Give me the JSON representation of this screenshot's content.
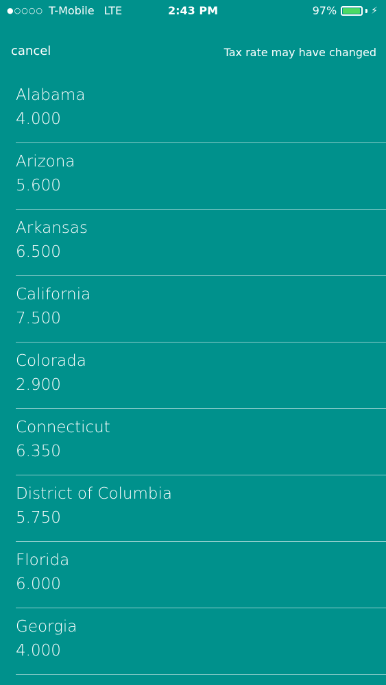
{
  "status_bar": {
    "signal": "●○○○○",
    "carrier": "T-Mobile",
    "network": "LTE",
    "time": "2:43 PM",
    "battery_percent": "97%",
    "battery_level": 0.97,
    "battery_color": "#4cd964"
  },
  "nav": {
    "cancel_label": "cancel",
    "message": "Tax rate may have changed"
  },
  "theme": {
    "background": "#00918c",
    "text": "#ffffff"
  },
  "states": [
    {
      "name": "Alabama",
      "rate": "4.000"
    },
    {
      "name": "Arizona",
      "rate": "5.600"
    },
    {
      "name": "Arkansas",
      "rate": "6.500"
    },
    {
      "name": "California",
      "rate": "7.500"
    },
    {
      "name": "Colorada",
      "rate": "2.900"
    },
    {
      "name": "Connecticut",
      "rate": "6.350"
    },
    {
      "name": "District of Columbia",
      "rate": "5.750"
    },
    {
      "name": "Florida",
      "rate": "6.000"
    },
    {
      "name": "Georgia",
      "rate": "4.000"
    }
  ]
}
